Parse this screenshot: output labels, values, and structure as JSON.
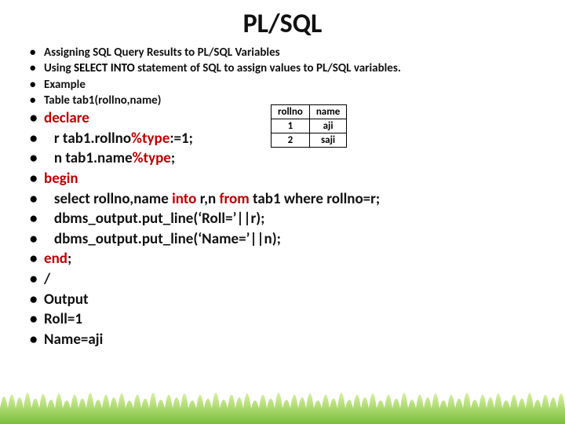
{
  "title": "PL/SQL",
  "intro": {
    "l1": "Assigning SQL Query Results to PL/SQL Variables",
    "l2_a": "Using ",
    "l2_b": "SELECT INTO",
    "l2_c": " statement of SQL to assign values to PL/SQL variables.",
    "l3": "Example",
    "l4": "Table tab1(rollno,name)"
  },
  "table": {
    "h1": "rollno",
    "h2": "name",
    "r1c1": "1",
    "r1c2": "aji",
    "r2c1": "2",
    "r2c2": "saji"
  },
  "code": {
    "l1_kw": "declare",
    "l2_a": "   r tab1.rollno",
    "l2_kw": "%type",
    "l2_b": ":=1;",
    "l3_a": "   n tab1.name",
    "l3_kw": "%type",
    "l3_b": ";",
    "l4_kw": "begin",
    "l5_a": "   select rollno,name ",
    "l5_kw1": " into",
    "l5_b": " r,n ",
    "l5_kw2": "from",
    "l5_c": " tab1 where rollno=r;",
    "l6": "   dbms_output.put_line(‘Roll=’||r);",
    "l7": "   dbms_output.put_line(‘Name=’||n);",
    "l8_kw": "end",
    "l8_b": ";",
    "l9": "/",
    "l10": "Output",
    "l11": "Roll=1",
    "l12": "Name=aji"
  }
}
